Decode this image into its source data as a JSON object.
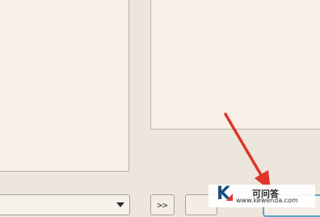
{
  "toolbar": {
    "forward_label": ">>",
    "blank_button_label": "",
    "focused_button_label": ""
  },
  "combo": {
    "value": ""
  },
  "watermark": {
    "logo": "K",
    "title": "可问答",
    "url": "www.kewenda.com"
  },
  "colors": {
    "background": "#ede6dc",
    "panel": "#f8f0e6",
    "focus_border": "#5ea5c9",
    "annotation_arrow": "#e03428"
  },
  "icons": {
    "combo_arrow": "chevron-down-icon",
    "annotation": "red-arrow-icon"
  }
}
